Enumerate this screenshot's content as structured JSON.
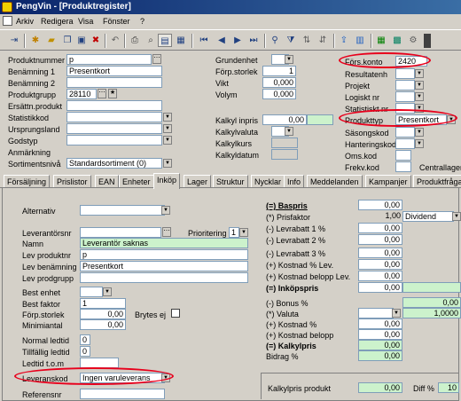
{
  "window": {
    "title": "PengVin - [Produktregister]"
  },
  "menu": [
    "Arkiv",
    "Redigera",
    "Visa",
    "Fönster",
    "?"
  ],
  "toolbar": {
    "icons": [
      "new-record-icon",
      "add-icon",
      "open-folder-icon",
      "copy-icon",
      "save-icon",
      "delete-icon",
      "undo-icon",
      "print-icon",
      "print-preview-icon",
      "form-view-icon",
      "table-view-icon",
      "first-record-icon",
      "previous-record-icon",
      "next-record-icon",
      "last-record-icon",
      "binoculars-icon",
      "filter-icon",
      "sort-icon",
      "sort-desc-icon",
      "export-icon",
      "report-icon",
      "calendar-icon"
    ]
  },
  "header_left": {
    "produktnummer": {
      "label": "Produktnummer",
      "value": "p"
    },
    "benamning1": {
      "label": "Benämning 1",
      "value": "Presentkort"
    },
    "benamning2": {
      "label": "Benämning 2",
      "value": ""
    },
    "produktgrupp": {
      "label": "Produktgrupp",
      "value": "28110"
    },
    "ersattn": {
      "label": "Ersättn.produkt",
      "value": ""
    },
    "statistikkod": {
      "label": "Statistikkod",
      "value": ""
    },
    "ursprungsland": {
      "label": "Ursprungsland",
      "value": ""
    },
    "godstyp": {
      "label": "Godstyp",
      "value": ""
    },
    "anmarkning": {
      "label": "Anmärkning",
      "value": ""
    },
    "sortimentsniva": {
      "label": "Sortimentsnivå",
      "value": "Standardsortiment (0)"
    }
  },
  "header_mid": {
    "grundenhet": {
      "label": "Grundenhet",
      "value": ""
    },
    "forpstorlek": {
      "label": "Förp.storlek",
      "value": "1"
    },
    "vikt": {
      "label": "Vikt",
      "value": "0,000"
    },
    "volym": {
      "label": "Volym",
      "value": "0,000"
    },
    "kalkylinpris": {
      "label": "Kalkyl inpris",
      "value": "0,00"
    },
    "kalkylvaluta": {
      "label": "Kalkylvaluta",
      "value": ""
    },
    "kalkylkurs": {
      "label": "Kalkylkurs",
      "value": ""
    },
    "kalkyldatum": {
      "label": "Kalkyldatum",
      "value": ""
    }
  },
  "header_right": {
    "forskonto": {
      "label": "Förs.konto",
      "value": "2420"
    },
    "resultatenh": {
      "label": "Resultatenh",
      "value": ""
    },
    "projekt": {
      "label": "Projekt",
      "value": ""
    },
    "logisktnr": {
      "label": "Logiskt nr",
      "value": ""
    },
    "statistisktnr": {
      "label": "Statistiskt nr",
      "value": ""
    },
    "produkttyp": {
      "label": "Produkttyp",
      "value": "Presentkort"
    },
    "sasongskod": {
      "label": "Säsongskod",
      "value": ""
    },
    "hanteringskod": {
      "label": "Hanteringskod",
      "value": ""
    },
    "omskod": {
      "label": "Oms.kod",
      "value": ""
    },
    "frekvkod": {
      "label": "Frekv.kod",
      "value": ""
    },
    "centrallager": {
      "label": "Centrallager",
      "value": ""
    }
  },
  "tabs": [
    "Försäljning",
    "Prislistor",
    "EAN",
    "Enheter",
    "Inköp",
    "Lager",
    "Struktur",
    "Nycklar",
    "Info",
    "Meddelanden",
    "Kampanjer",
    "Produktfråga"
  ],
  "active_tab": "Inköp",
  "inkop": {
    "alternativ": {
      "label": "Alternativ",
      "value": ""
    },
    "leverantorsnr": {
      "label": "Leverantörsnr",
      "value": ""
    },
    "prioritering": {
      "label": "Prioritering",
      "value": "1"
    },
    "namn": {
      "label": "Namn",
      "value": "Leverantör saknas"
    },
    "levproduktnr": {
      "label": "Lev produktnr",
      "value": "p"
    },
    "levbenamning": {
      "label": "Lev benämning",
      "value": "Presentkort"
    },
    "levprodgrupp": {
      "label": "Lev prodgrupp",
      "value": ""
    },
    "bestenhet": {
      "label": "Best enhet",
      "value": ""
    },
    "bestfaktor": {
      "label": "Best faktor",
      "value": "1"
    },
    "forpstorlek": {
      "label": "Förp.storlek",
      "value": "0,00"
    },
    "brytesej": {
      "label": "Brytes ej"
    },
    "minimiantal": {
      "label": "Minimiantal",
      "value": "0,00"
    },
    "normalledtid": {
      "label": "Normal ledtid",
      "value": "0"
    },
    "tillfalligledtid": {
      "label": "Tillfällig ledtid",
      "value": "0"
    },
    "ledtidtom": {
      "label": "Ledtid t.o.m",
      "value": ""
    },
    "leveranskod": {
      "label": "Leveranskod",
      "value": "Ingen varuleverans"
    },
    "referensnr": {
      "label": "Referensnr",
      "value": ""
    }
  },
  "kalkyl": {
    "rows": [
      {
        "label": "(=) Baspris",
        "value": "0,00",
        "extra": ""
      },
      {
        "label": "(*) Prisfaktor",
        "value": "1,00",
        "extra": "Dividend"
      },
      {
        "label": "(-) Levrabatt 1 %",
        "value": "0,00",
        "extra": ""
      },
      {
        "label": "(-) Levrabatt 2 %",
        "value": "0,00",
        "extra": ""
      },
      {
        "label": "(-) Levrabatt 3 %",
        "value": "0,00",
        "extra": ""
      },
      {
        "label": "(+) Kostnad % Lev.",
        "value": "0,00",
        "extra": ""
      },
      {
        "label": "(+) Kostnad belopp Lev.",
        "value": "0,00",
        "extra": ""
      },
      {
        "label": "(=) Inköpspris",
        "value": "0,00",
        "extra": ""
      },
      {
        "label": "(-) Bonus %",
        "value": "",
        "extra": "0,00"
      },
      {
        "label": "(*) Valuta",
        "value": "",
        "extra": "1,0000"
      },
      {
        "label": "(+) Kostnad %",
        "value": "0,00",
        "extra": ""
      },
      {
        "label": "(+) Kostnad belopp",
        "value": "0,00",
        "extra": ""
      },
      {
        "label": "(=) Kalkylpris",
        "value": "0,00",
        "extra": ""
      },
      {
        "label": "Bidrag %",
        "value": "0,00",
        "extra": ""
      }
    ],
    "kalkylpris_produkt": {
      "label": "Kalkylpris produkt",
      "value": "0,00"
    },
    "diff": {
      "label": "Diff %",
      "value": "10"
    }
  }
}
